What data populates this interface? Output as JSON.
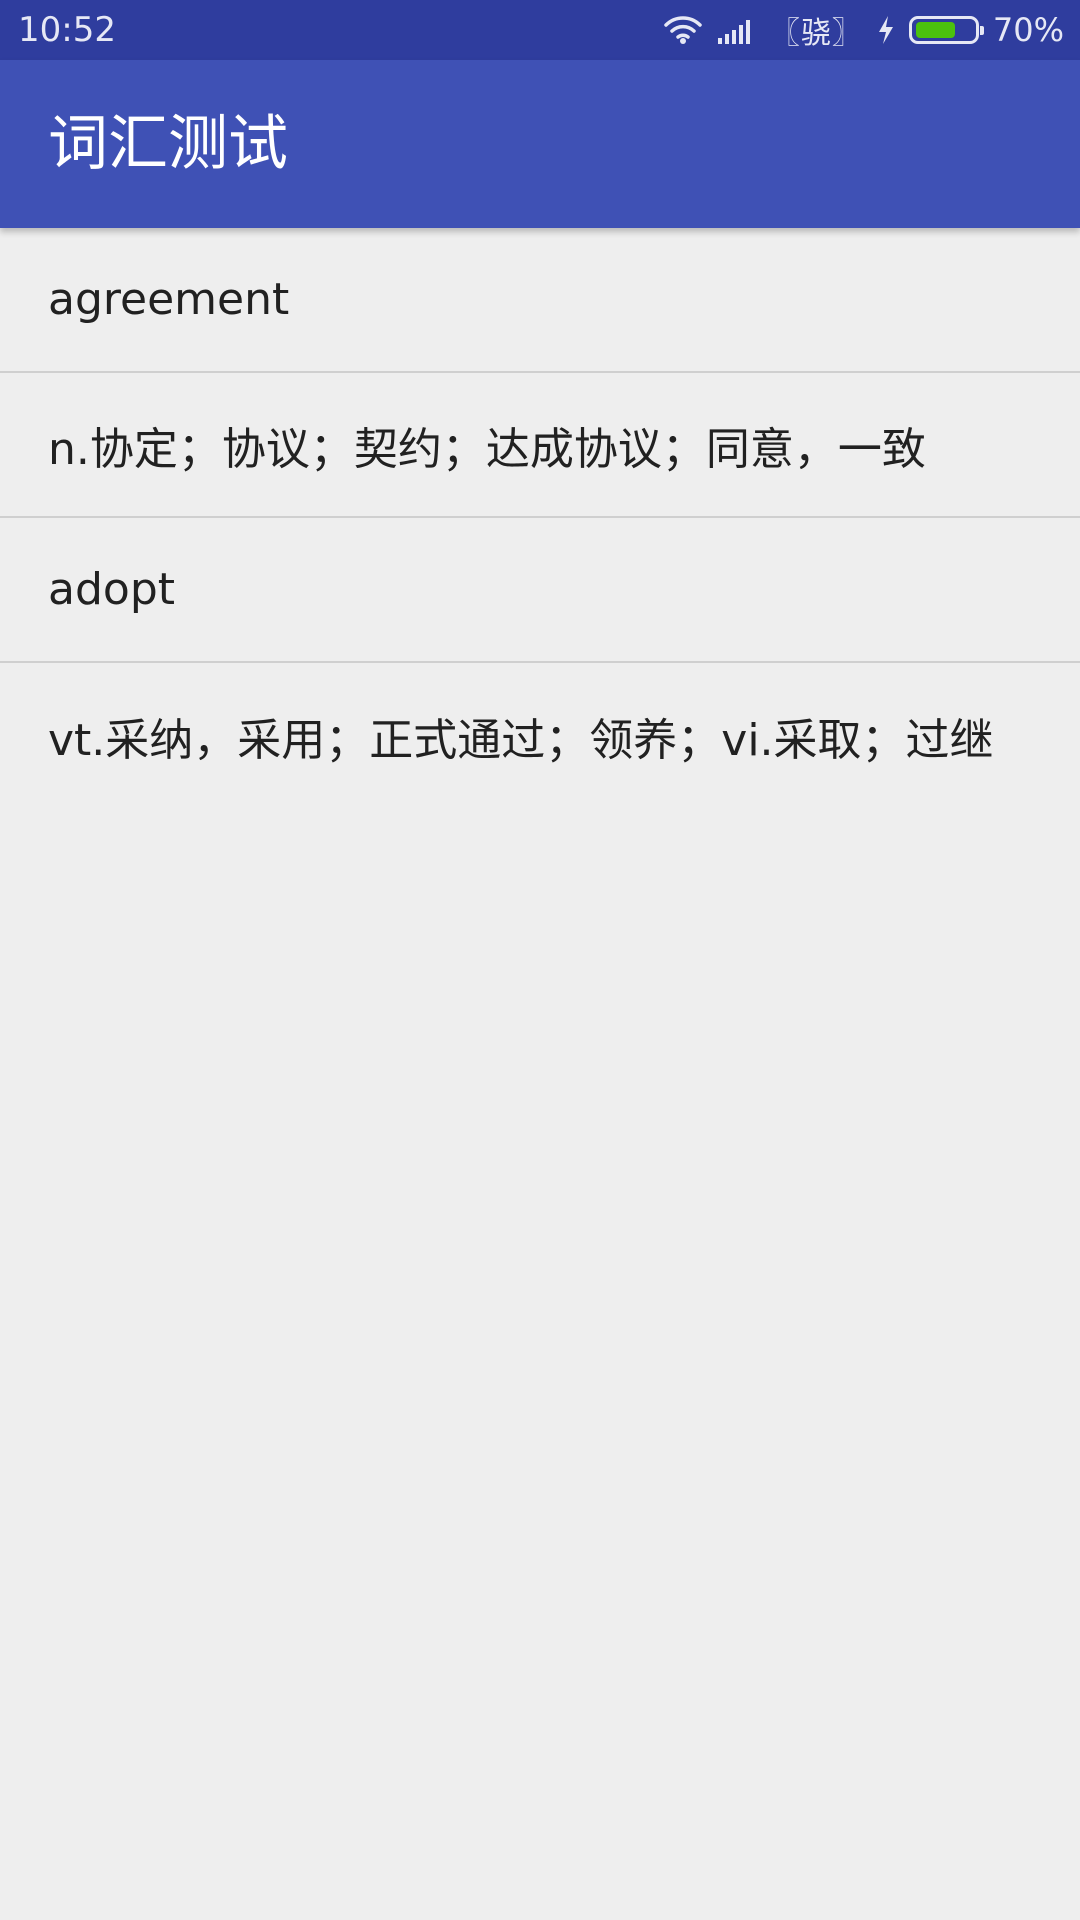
{
  "status_bar": {
    "time": "10:52",
    "carrier": "〖骁〗",
    "battery_percent_text": "70%",
    "battery_level": 0.7,
    "battery_color": "#4bc10e",
    "icons": [
      "wifi-icon",
      "signal-icon",
      "charging-bolt-icon",
      "battery-icon"
    ]
  },
  "app_bar": {
    "title": "词汇测试",
    "color": "#3f51b5"
  },
  "list": {
    "items": [
      {
        "text": "agreement"
      },
      {
        "text": "n.协定；协议；契约；达成协议；同意，一致"
      },
      {
        "text": "adopt"
      },
      {
        "text": "vt.采纳，采用；正式通过；领养；vi.采取；过继"
      }
    ]
  }
}
